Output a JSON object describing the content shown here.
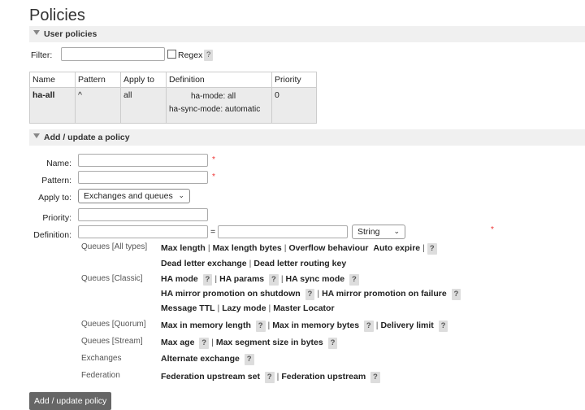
{
  "page_title": "Policies",
  "user_policies": {
    "section_title": "User policies",
    "filter_label": "Filter:",
    "regex_label": "Regex",
    "help": "?",
    "table": {
      "headers": [
        "Name",
        "Pattern",
        "Apply to",
        "Definition",
        "Priority"
      ],
      "row": {
        "name": "ha-all",
        "pattern": "^",
        "apply_to": "all",
        "definitions": [
          {
            "key": "ha-mode:",
            "value": "all"
          },
          {
            "key": "ha-sync-mode:",
            "value": "automatic"
          }
        ],
        "priority": "0"
      }
    }
  },
  "add_policy": {
    "section_title": "Add / update a policy",
    "name_label": "Name:",
    "pattern_label": "Pattern:",
    "apply_to_label": "Apply to:",
    "apply_to_value": "Exchanges and queues",
    "priority_label": "Priority:",
    "definition_label": "Definition:",
    "equals": "=",
    "type_value": "String",
    "required_mark": "*",
    "help": "?",
    "submit_label": "Add / update policy",
    "categories": {
      "all_types": {
        "label": "Queues [All types]",
        "line1": [
          "Max length",
          "Max length bytes",
          "Overflow behaviour",
          "Auto expire"
        ],
        "line2": [
          "Dead letter exchange",
          "Dead letter routing key"
        ]
      },
      "classic": {
        "label": "Queues [Classic]",
        "line1": [
          "HA mode",
          "HA params",
          "HA sync mode"
        ],
        "line2": [
          "HA mirror promotion on shutdown",
          "HA mirror promotion on failure"
        ],
        "line3": [
          "Message TTL",
          "Lazy mode",
          "Master Locator"
        ]
      },
      "quorum": {
        "label": "Queues [Quorum]",
        "items": [
          "Max in memory length",
          "Max in memory bytes",
          "Delivery limit"
        ]
      },
      "stream": {
        "label": "Queues [Stream]",
        "items": [
          "Max age",
          "Max segment size in bytes"
        ]
      },
      "exchanges": {
        "label": "Exchanges",
        "items": [
          "Alternate exchange"
        ]
      },
      "federation": {
        "label": "Federation",
        "items": [
          "Federation upstream set",
          "Federation upstream"
        ]
      }
    }
  }
}
